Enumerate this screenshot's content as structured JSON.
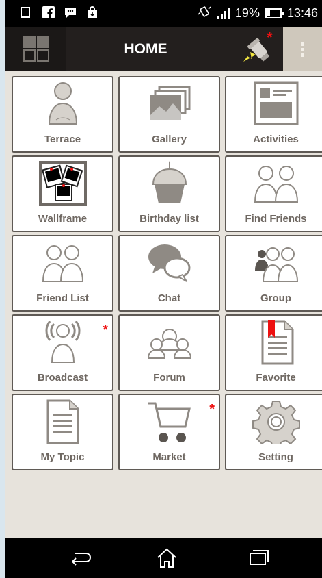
{
  "status_bar": {
    "battery_percent": "19%",
    "time": "13:46"
  },
  "app_bar": {
    "title": "HOME"
  },
  "tiles": [
    {
      "label": "Terrace",
      "icon": "person-icon",
      "badge": ""
    },
    {
      "label": "Gallery",
      "icon": "photos-icon",
      "badge": ""
    },
    {
      "label": "Activities",
      "icon": "newsfeed-icon",
      "badge": ""
    },
    {
      "label": "Wallframe",
      "icon": "polaroid-icon",
      "badge": ""
    },
    {
      "label": "Birthday list",
      "icon": "cupcake-icon",
      "badge": ""
    },
    {
      "label": "Find Friends",
      "icon": "two-people-icon",
      "badge": ""
    },
    {
      "label": "Friend List",
      "icon": "friends-icon",
      "badge": ""
    },
    {
      "label": "Chat",
      "icon": "chat-bubbles-icon",
      "badge": ""
    },
    {
      "label": "Group",
      "icon": "group-icon",
      "badge": ""
    },
    {
      "label": "Broadcast",
      "icon": "broadcast-icon",
      "badge": "*"
    },
    {
      "label": "Forum",
      "icon": "forum-icon",
      "badge": ""
    },
    {
      "label": "Favorite",
      "icon": "bookmark-icon",
      "badge": ""
    },
    {
      "label": "My Topic",
      "icon": "document-icon",
      "badge": ""
    },
    {
      "label": "Market",
      "icon": "cart-icon",
      "badge": "*"
    },
    {
      "label": "Setting",
      "icon": "gear-icon",
      "badge": ""
    }
  ],
  "colors": {
    "accent": "#e11111",
    "tile_border": "#5f5a55",
    "icon": "#8f8a84"
  }
}
